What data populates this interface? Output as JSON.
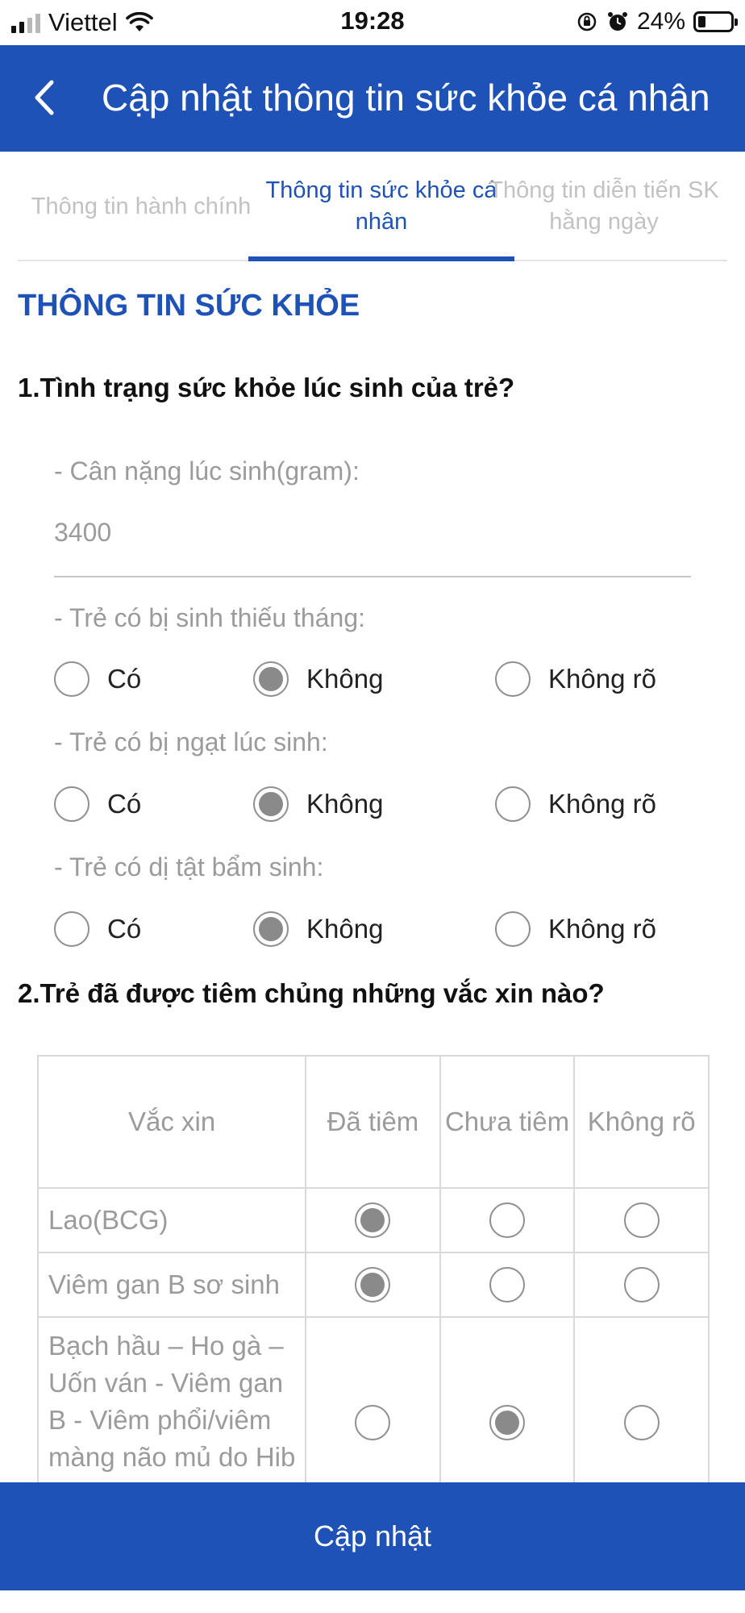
{
  "status_bar": {
    "carrier": "Viettel",
    "time": "19:28",
    "battery": "24%",
    "battery_level": 0.24
  },
  "header": {
    "title": "Cập nhật thông tin sức khỏe cá nhân",
    "back_icon": "chevron-left-icon"
  },
  "tabs": [
    {
      "label": "Thông tin hành chính",
      "active": false
    },
    {
      "label": "Thông tin sức khỏe cá nhân",
      "active": true
    },
    {
      "label": "Thông tin diễn tiến SK hằng ngày",
      "active": false
    }
  ],
  "section_title": "THÔNG TIN SỨC KHỎE",
  "q1": {
    "title": "1.Tình trạng sức khỏe lúc sinh của trẻ?",
    "weight_label": "- Cân nặng lúc sinh(gram):",
    "weight_value": "3400",
    "options": [
      "Có",
      "Không",
      "Không rõ"
    ],
    "items": [
      {
        "label": "- Trẻ có bị sinh thiếu tháng:",
        "selected": 1
      },
      {
        "label": "- Trẻ có bị ngạt lúc sinh:",
        "selected": 1
      },
      {
        "label": "- Trẻ có dị tật bẩm sinh:",
        "selected": 1
      }
    ]
  },
  "q2": {
    "title": "2.Trẻ đã được tiêm chủng những vắc xin nào?",
    "headers": [
      "Vắc xin",
      "Đã tiêm",
      "Chưa tiêm",
      "Không rõ"
    ],
    "rows": [
      {
        "name": "Lao(BCG)",
        "selected": 0
      },
      {
        "name": "Viêm gan B sơ sinh",
        "selected": 0
      },
      {
        "name": "Bạch hầu – Ho gà – Uốn ván - Viêm gan B - Viêm phổi/viêm màng não mủ do Hib",
        "selected": 1
      }
    ]
  },
  "footer": {
    "update_label": "Cập nhật"
  }
}
